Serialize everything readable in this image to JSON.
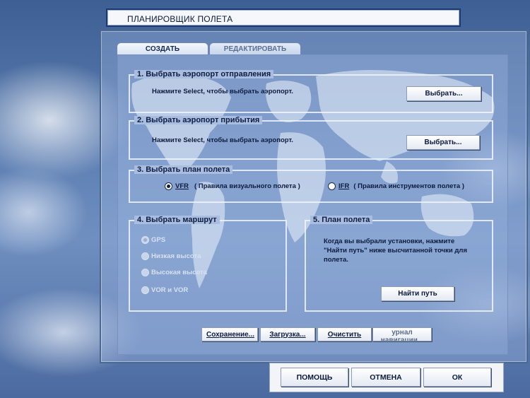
{
  "window": {
    "title": "ПЛАНИРОВЩИК ПОЛЕТА"
  },
  "tabs": [
    {
      "label": "СОЗДАТЬ",
      "active": true
    },
    {
      "label": "РЕДАКТИРОВАТЬ",
      "active": false
    }
  ],
  "departure": {
    "title": "1. Выбрать аэропорт отправления",
    "hint": "Нажмите Select, чтобы выбрать аэропорт.",
    "button": "Выбрать..."
  },
  "arrival": {
    "title": "2. Выбрать аэропорт прибытия",
    "hint": "Нажмите Select, чтобы выбрать аэропорт.",
    "button": "Выбрать..."
  },
  "flight_plan_type": {
    "title": "3. Выбрать план полета",
    "options": [
      {
        "code": "VFR",
        "desc": "( Правила визуального полета )",
        "selected": true
      },
      {
        "code": "IFR",
        "desc": "( Правила инструментов полета )",
        "selected": false
      }
    ]
  },
  "route": {
    "title": "4. Выбрать маршрут",
    "options": [
      {
        "label": "GPS",
        "selected": true
      },
      {
        "label": "Низкая высота",
        "selected": false
      },
      {
        "label": "Высокая высота",
        "selected": false
      },
      {
        "label": "VOR и VOR",
        "selected": false
      }
    ]
  },
  "plan": {
    "title": "5. План полета",
    "line1": "Когда вы выбрали установки, нажмите",
    "line2": "\"Найти путь\" ниже высчитанной точки для",
    "line3": "полета.",
    "button": "Найти путь"
  },
  "toolbar": {
    "save": "Сохранение...",
    "load": "Загрузка...",
    "clear": "Очистить",
    "navlog": "урнал навигации..."
  },
  "footer": {
    "help": "ПОМОЩЬ",
    "cancel": "ОТМЕНА",
    "ok": "ОК"
  },
  "colors": {
    "panel_border": "#4a6790",
    "text_dark": "#0d1c3e",
    "sky": "#5a7cb0"
  }
}
